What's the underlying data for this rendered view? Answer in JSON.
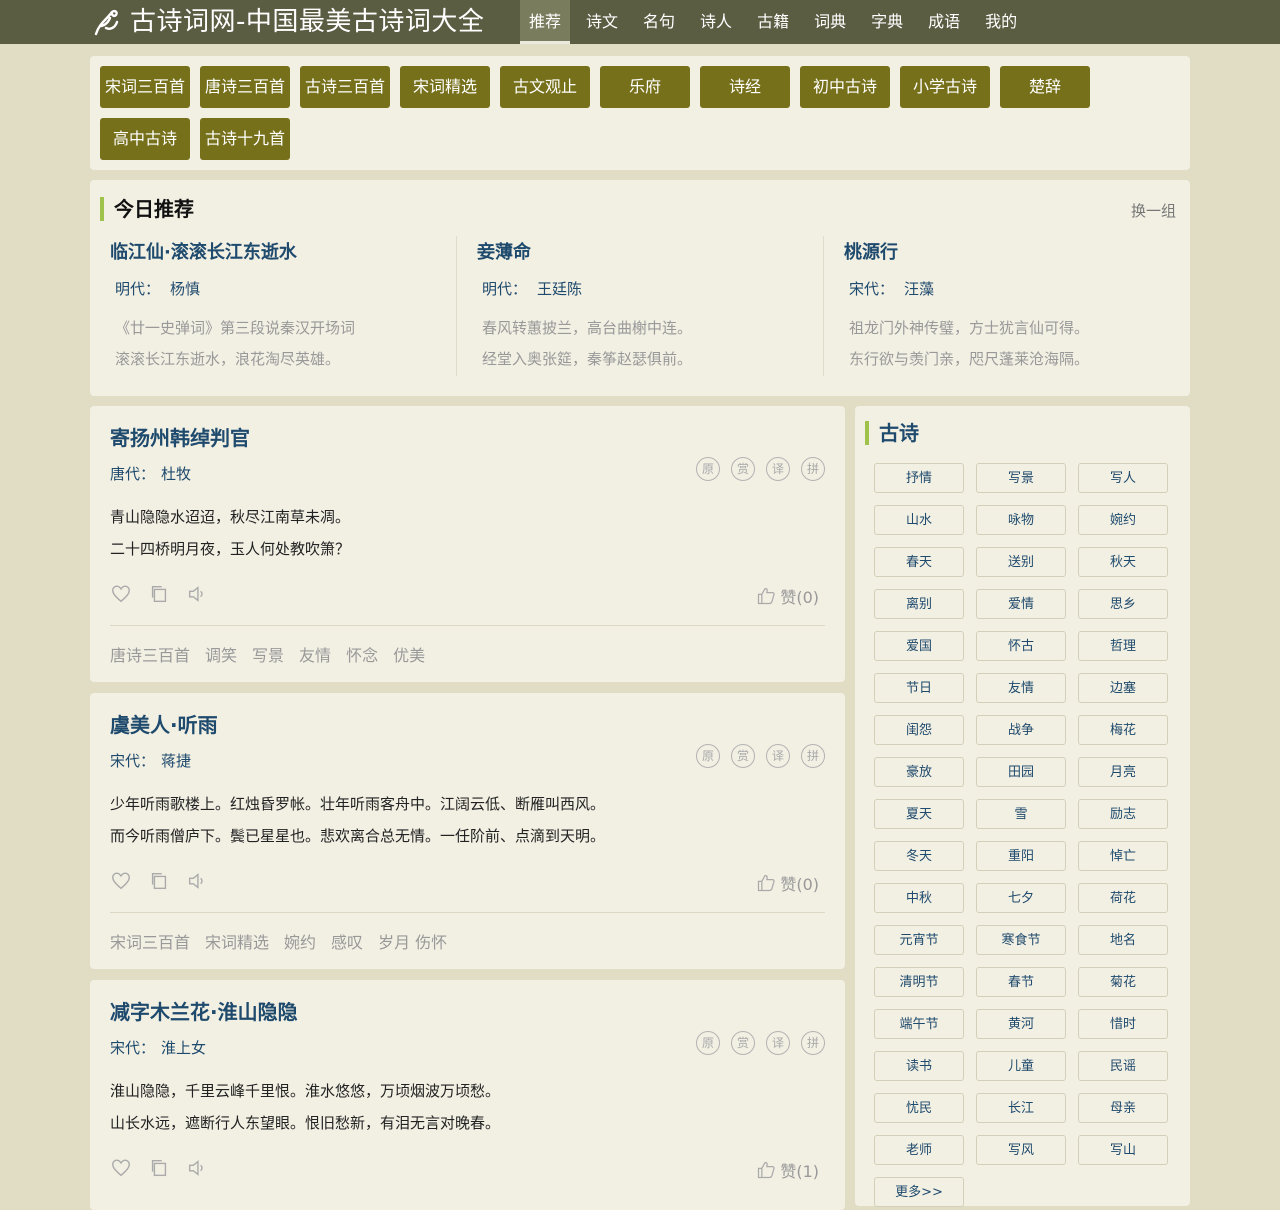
{
  "header": {
    "site_title": "古诗词网-中国最美古诗词大全",
    "nav": [
      "推荐",
      "诗文",
      "名句",
      "诗人",
      "古籍",
      "词典",
      "字典",
      "成语",
      "我的"
    ]
  },
  "collections": [
    "宋词三百首",
    "唐诗三百首",
    "古诗三百首",
    "宋词精选",
    "古文观止",
    "乐府",
    "诗经",
    "初中古诗",
    "小学古诗",
    "楚辞",
    "高中古诗",
    "古诗十九首"
  ],
  "today": {
    "title": "今日推荐",
    "refresh": "换一组",
    "items": [
      {
        "title": "临江仙·滚滚长江东逝水",
        "dynasty": "明代：",
        "author": "杨慎",
        "lines": [
          "《廿一史弹词》第三段说秦汉开场词",
          "滚滚长江东逝水，浪花淘尽英雄。"
        ]
      },
      {
        "title": "妾薄命",
        "dynasty": "明代：",
        "author": "王廷陈",
        "lines": [
          "春风转蕙披兰，高台曲榭中连。",
          "经堂入奥张筵，秦筝赵瑟俱前。"
        ]
      },
      {
        "title": "桃源行",
        "dynasty": "宋代：",
        "author": "汪藻",
        "lines": [
          "祖龙门外神传璧，方士犹言仙可得。",
          "东行欲与羡门亲，咫尺蓬莱沧海隔。"
        ]
      }
    ]
  },
  "poem_tools": [
    "原",
    "赏",
    "译",
    "拼"
  ],
  "poems": [
    {
      "title": "寄扬州韩绰判官",
      "dynasty": "唐代：",
      "author": "杜牧",
      "lines": [
        "青山隐隐水迢迢，秋尽江南草未凋。",
        "二十四桥明月夜，玉人何处教吹箫？"
      ],
      "likes": "赞(0)",
      "tags": [
        "唐诗三百首",
        "调笑",
        "写景",
        "友情",
        "怀念",
        "优美"
      ]
    },
    {
      "title": "虞美人·听雨",
      "dynasty": "宋代：",
      "author": "蒋捷",
      "lines": [
        "少年听雨歌楼上。红烛昏罗帐。壮年听雨客舟中。江阔云低、断雁叫西风。",
        "而今听雨僧庐下。鬓已星星也。悲欢离合总无情。一任阶前、点滴到天明。"
      ],
      "likes": "赞(0)",
      "tags": [
        "宋词三百首",
        "宋词精选",
        "婉约",
        "感叹",
        "岁月 伤怀"
      ]
    },
    {
      "title": "减字木兰花·淮山隐隐",
      "dynasty": "宋代：",
      "author": "淮上女",
      "lines": [
        "淮山隐隐，千里云峰千里恨。淮水悠悠，万顷烟波万顷愁。",
        "山长水远，遮断行人东望眼。恨旧愁新，有泪无言对晚春。"
      ],
      "likes": "赞(1)",
      "tags": []
    }
  ],
  "sidebar": {
    "title": "古诗",
    "categories": [
      "抒情",
      "写景",
      "写人",
      "山水",
      "咏物",
      "婉约",
      "春天",
      "送别",
      "秋天",
      "离别",
      "爱情",
      "思乡",
      "爱国",
      "怀古",
      "哲理",
      "节日",
      "友情",
      "边塞",
      "闺怨",
      "战争",
      "梅花",
      "豪放",
      "田园",
      "月亮",
      "夏天",
      "雪",
      "励志",
      "冬天",
      "重阳",
      "悼亡",
      "中秋",
      "七夕",
      "荷花",
      "元宵节",
      "寒食节",
      "地名",
      "清明节",
      "春节",
      "菊花",
      "端午节",
      "黄河",
      "惜时",
      "读书",
      "儿童",
      "民谣",
      "忧民",
      "长江",
      "母亲",
      "老师",
      "写风",
      "写山",
      "更多>>"
    ]
  },
  "colors": {
    "header_bg": "#5b5d43",
    "accent_button": "#76701a",
    "link_blue": "#1e4a6d",
    "title_bar": "#9fc24a",
    "page_bg": "#e1dcc4",
    "card_bg": "#f2efe3"
  }
}
